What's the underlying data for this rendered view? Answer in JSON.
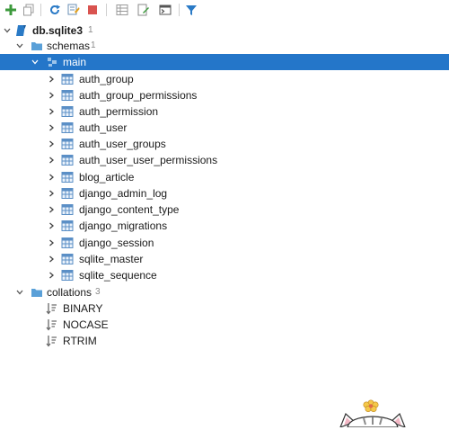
{
  "toolbar": {
    "buttons": [
      {
        "icon": "add-icon"
      },
      {
        "icon": "copy-icon"
      },
      {
        "icon": "refresh-icon"
      },
      {
        "icon": "properties-icon"
      },
      {
        "icon": "stop-icon"
      },
      {
        "icon": "table-view-icon"
      },
      {
        "icon": "edit-icon"
      },
      {
        "icon": "console-icon"
      },
      {
        "icon": "filter-icon"
      }
    ]
  },
  "tree": {
    "root": {
      "label": "db.sqlite3",
      "count": "1"
    },
    "schemas": {
      "label": "schemas",
      "count": "1"
    },
    "main": {
      "label": "main"
    },
    "tables": [
      "auth_group",
      "auth_group_permissions",
      "auth_permission",
      "auth_user",
      "auth_user_groups",
      "auth_user_user_permissions",
      "blog_article",
      "django_admin_log",
      "django_content_type",
      "django_migrations",
      "django_session",
      "sqlite_master",
      "sqlite_sequence"
    ],
    "collations": {
      "label": "collations",
      "count": "3"
    },
    "collation_items": [
      "BINARY",
      "NOCASE",
      "RTRIM"
    ]
  },
  "colors": {
    "selection": "#2476c9",
    "folder": "#5aa0d8",
    "table_icon": "#5b8fc6",
    "accent_green": "#3c9a3c",
    "stop_red": "#d9534f"
  }
}
